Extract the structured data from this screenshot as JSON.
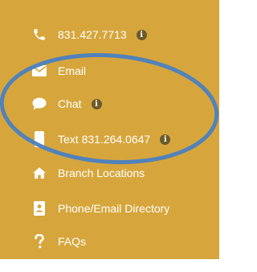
{
  "menu": {
    "items": [
      {
        "label": "831.427.7713",
        "icon": "phone-icon",
        "info": true
      },
      {
        "label": "Email",
        "icon": "envelope-icon",
        "info": false
      },
      {
        "label": "Chat",
        "icon": "chat-bubble-icon",
        "info": true
      },
      {
        "label": "Text 831.264.0647",
        "icon": "mobile-phone-icon",
        "info": true
      },
      {
        "label": "Branch Locations",
        "icon": "home-icon",
        "info": false
      },
      {
        "label": "Phone/Email Directory",
        "icon": "address-book-icon",
        "info": false
      },
      {
        "label": "FAQs",
        "icon": "question-mark-icon",
        "info": false
      }
    ],
    "info_glyph": "i"
  },
  "colors": {
    "panel_background": "#d6a63c",
    "text": "#ffffff",
    "info_badge": "#6b5a2a",
    "annotation_circle": "#4a7fc1"
  }
}
